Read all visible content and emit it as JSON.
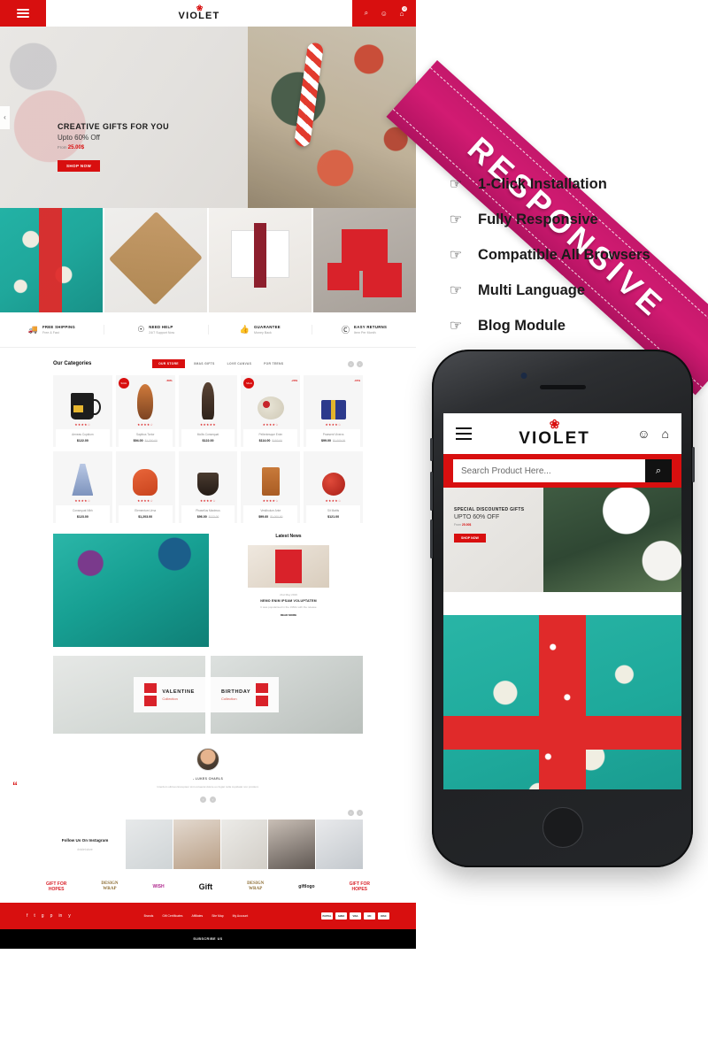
{
  "brand": {
    "name": "VIOLET",
    "bow_icon": "bow-icon",
    "accent": "#d80f0f",
    "ribbon_color": "#c4186b"
  },
  "header": {
    "menu_icon": "hamburger-icon",
    "search_icon": "⌕",
    "user_icon": "☺",
    "cart_icon": "⛉",
    "cart_count": "0"
  },
  "hero": {
    "title": "CREATIVE GIFTS FOR YOU",
    "subtitle": "Upto 60% Off",
    "from_label": "From",
    "from_price": "25.00$",
    "button": "SHOP NOW",
    "prev_arrow": "‹",
    "next_arrow": "›"
  },
  "banners": [
    {
      "name": "teal-polka-gift"
    },
    {
      "name": "kraft-ribbon-gift"
    },
    {
      "name": "hands-holding-gifts"
    },
    {
      "name": "red-wrapped-gifts"
    }
  ],
  "services": [
    {
      "icon": "truck-icon",
      "title": "FREE SHIPPING",
      "sub": "Free & Fast"
    },
    {
      "icon": "headset-icon",
      "title": "NEED HELP",
      "sub": "24/7 Support Now"
    },
    {
      "icon": "thumbs-up-icon",
      "title": "GUARANTEE",
      "sub": "Money Back"
    },
    {
      "icon": "refresh-icon",
      "title": "EASY RETURNS",
      "sub": "Item Per Month"
    }
  ],
  "categories": {
    "title": "Our Categories",
    "tabs": [
      {
        "label": "OUR STORE",
        "active": true
      },
      {
        "label": "XMAS GIFTS",
        "active": false
      },
      {
        "label": "LOVE CANVAS",
        "active": false
      },
      {
        "label": "FOR TEENS",
        "active": false
      }
    ],
    "prev": "‹",
    "next": "›"
  },
  "products": [
    {
      "shape": "sh-mug",
      "name": "Aeneas Cupidum",
      "price": "$122.00",
      "old": "",
      "stars": "★★★★☆",
      "sale": "",
      "off": ""
    },
    {
      "shape": "sh-mask",
      "name": "Sapibus Tortor",
      "price": "$94.00",
      "old": "$1,200.00",
      "stars": "★★★★☆",
      "sale": "SALE",
      "off": "-50%"
    },
    {
      "shape": "sh-fig",
      "name": "Mollis Consequat",
      "price": "$122.00",
      "old": "",
      "stars": "★★★★★",
      "sale": "",
      "off": ""
    },
    {
      "shape": "sh-food",
      "name": "Pellentesque Enim",
      "price": "$114.00",
      "old": "$153.00",
      "stars": "★★★★☆",
      "sale": "SALE",
      "off": "-20%"
    },
    {
      "shape": "sh-box",
      "name": "Praesent Viverra",
      "price": "$99.00",
      "old": "$1,000.00",
      "stars": "★★★★☆",
      "sale": "",
      "off": "-15%"
    },
    {
      "shape": "sh-dress",
      "name": "Consequat Nibh",
      "price": "$123.00",
      "old": "",
      "stars": "★★★★☆",
      "sale": "",
      "off": ""
    },
    {
      "shape": "sh-fox",
      "name": "Elementum Urna",
      "price": "$1,203.00",
      "old": "",
      "stars": "★★★★☆",
      "sale": "",
      "off": ""
    },
    {
      "shape": "sh-cup",
      "name": "Phasellus Maximus",
      "price": "$96.00",
      "old": "$122.00",
      "stars": "★★★★☆",
      "sale": "",
      "off": ""
    },
    {
      "shape": "sh-copper",
      "name": "Vestibulum Ante",
      "price": "$99.60",
      "old": "$1,000.00",
      "stars": "★★★★☆",
      "sale": "",
      "off": ""
    },
    {
      "shape": "sh-apple",
      "name": "Sit Mattis",
      "price": "$121.00",
      "old": "",
      "stars": "★★★★☆",
      "sale": "",
      "off": ""
    }
  ],
  "news": {
    "title": "Latest News",
    "date": "21st May 2019",
    "headline": "NEMO ENIM IPSAM VOLUPTATEM",
    "excerpt": "It was popularised in the 1960s with the release",
    "read_more": "READ MORE"
  },
  "collections": [
    {
      "title": "VALENTINE",
      "subtitle": "Collection",
      "icon": "gift-ribbon-icon"
    },
    {
      "title": "BIRTHDAY",
      "subtitle": "Collection",
      "icon": "gift-ribbon-icon"
    }
  ],
  "testimonial": {
    "quote_icon": "“",
    "name": "- LUKES CHARLS",
    "text": "Interdum ultrices Excepteur sint occaecat dolore eu fugiat nulla cupidatat non proident.",
    "prev": "‹",
    "next": "›"
  },
  "instagram": {
    "title": "Follow Us On Instagram",
    "handle": "#violet.store",
    "prev": "‹",
    "next": "›"
  },
  "brands": [
    {
      "line1": "GIFT FOR",
      "line2": "HOPES",
      "class": "bk1"
    },
    {
      "line1": "DESIGN",
      "line2": "WRAP",
      "class": "bk2"
    },
    {
      "line1": "WISH",
      "line2": "",
      "class": "bk3"
    },
    {
      "line1": "Gift",
      "line2": "",
      "class": "bk4"
    },
    {
      "line1": "DESIGN",
      "line2": "WRAP",
      "class": "bk5"
    },
    {
      "line1": "giftlogo",
      "line2": "",
      "class": "bk6"
    },
    {
      "line1": "GIFT FOR",
      "line2": "HOPES",
      "class": "bk7"
    }
  ],
  "footer": {
    "social": [
      "f",
      "t",
      "g",
      "p",
      "in",
      "y"
    ],
    "links": [
      "Brands",
      "Gift Certificates",
      "Affiliates",
      "Site Map",
      "My Account"
    ],
    "payments": [
      "PAYPAL",
      "AMEX",
      "VISA",
      "MC",
      "DISC"
    ],
    "subscribe_title": "SUBSCRIBE US"
  },
  "promo": {
    "ribbon": "RESPONSIVE",
    "features": [
      {
        "icon": "pointing-hand-icon",
        "label": "1-Click Installation"
      },
      {
        "icon": "pointing-hand-icon",
        "label": "Fully Responsive"
      },
      {
        "icon": "pointing-hand-icon",
        "label": "Compatible All Browsers"
      },
      {
        "icon": "pointing-hand-icon",
        "label": "Multi Language"
      },
      {
        "icon": "pointing-hand-icon",
        "label": "Blog Module"
      }
    ]
  },
  "mobile": {
    "logo": "VIOLET",
    "menu_icon": "hamburger-icon",
    "user_icon": "☺",
    "cart_icon": "⛉",
    "search_placeholder": "Search Product Here...",
    "search_icon": "⌕",
    "hero_title": "SPECIAL DISCOUNTED GIFTS",
    "hero_sub": "UPTO 60% OFF",
    "hero_from_label": "From",
    "hero_from_price": "25.00$",
    "hero_button": "SHOP NOW"
  }
}
